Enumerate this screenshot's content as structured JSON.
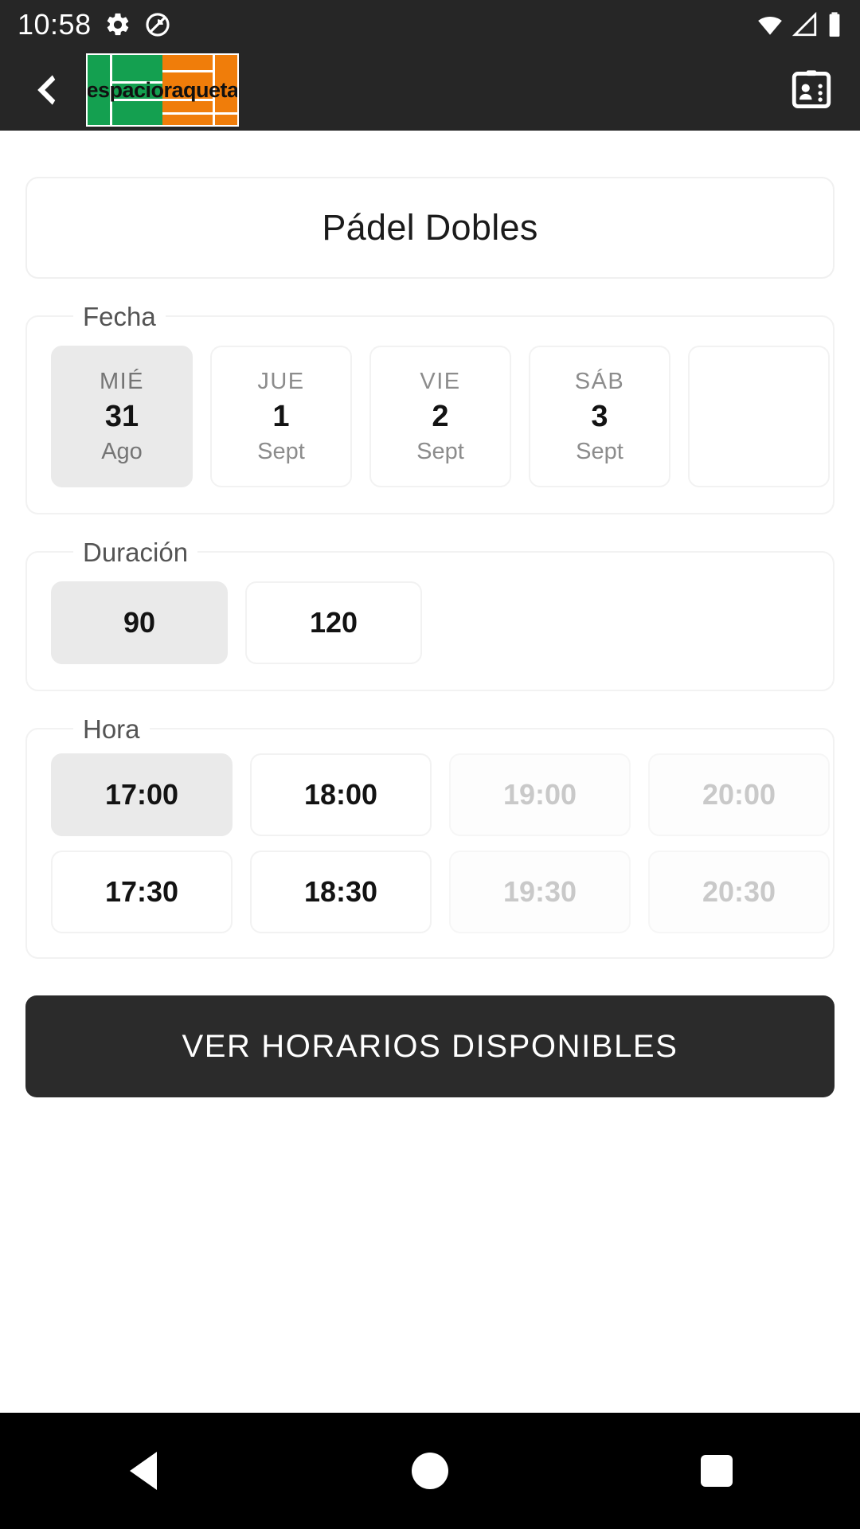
{
  "status_bar": {
    "clock": "10:58",
    "icons_left": [
      "gear-icon",
      "do-not-disturb-icon"
    ],
    "icons_right": [
      "wifi-icon",
      "signal-icon",
      "battery-icon"
    ]
  },
  "app_bar": {
    "back_icon": "back-chevron-icon",
    "contacts_icon": "contact-card-icon",
    "logo": {
      "text_left": "espacio",
      "text_right": "raqueta",
      "color_green": "#14a050",
      "color_orange": "#f07d0a"
    }
  },
  "title": {
    "text": "Pádel Dobles"
  },
  "fecha": {
    "legend": "Fecha",
    "chips": [
      {
        "dow": "MIÉ",
        "day": "31",
        "month": "Ago",
        "selected": true
      },
      {
        "dow": "JUE",
        "day": "1",
        "month": "Sept",
        "selected": false
      },
      {
        "dow": "VIE",
        "day": "2",
        "month": "Sept",
        "selected": false
      },
      {
        "dow": "SÁB",
        "day": "3",
        "month": "Sept",
        "selected": false
      },
      {
        "dow": "",
        "day": "",
        "month": "",
        "selected": false
      }
    ]
  },
  "duracion": {
    "legend": "Duración",
    "chips": [
      {
        "label": "90",
        "selected": true
      },
      {
        "label": "120",
        "selected": false
      }
    ]
  },
  "hora": {
    "legend": "Hora",
    "chips": [
      {
        "label": "17:00",
        "selected": true,
        "disabled": false
      },
      {
        "label": "18:00",
        "selected": false,
        "disabled": false
      },
      {
        "label": "19:00",
        "selected": false,
        "disabled": true
      },
      {
        "label": "20:00",
        "selected": false,
        "disabled": true
      },
      {
        "label": "17:30",
        "selected": false,
        "disabled": false
      },
      {
        "label": "18:30",
        "selected": false,
        "disabled": false
      },
      {
        "label": "19:30",
        "selected": false,
        "disabled": true
      },
      {
        "label": "20:30",
        "selected": false,
        "disabled": true
      }
    ]
  },
  "cta": {
    "label": "VER HORARIOS DISPONIBLES",
    "background": "#2b2b2b"
  },
  "nav_bar": {
    "back_label": "back-triangle-icon",
    "home_label": "home-circle-icon",
    "recents_label": "recents-square-icon"
  },
  "theme": {
    "app_bar_bg": "#262626",
    "chip_selected_bg": "#eaeaea",
    "border": "#f2f2f2"
  }
}
